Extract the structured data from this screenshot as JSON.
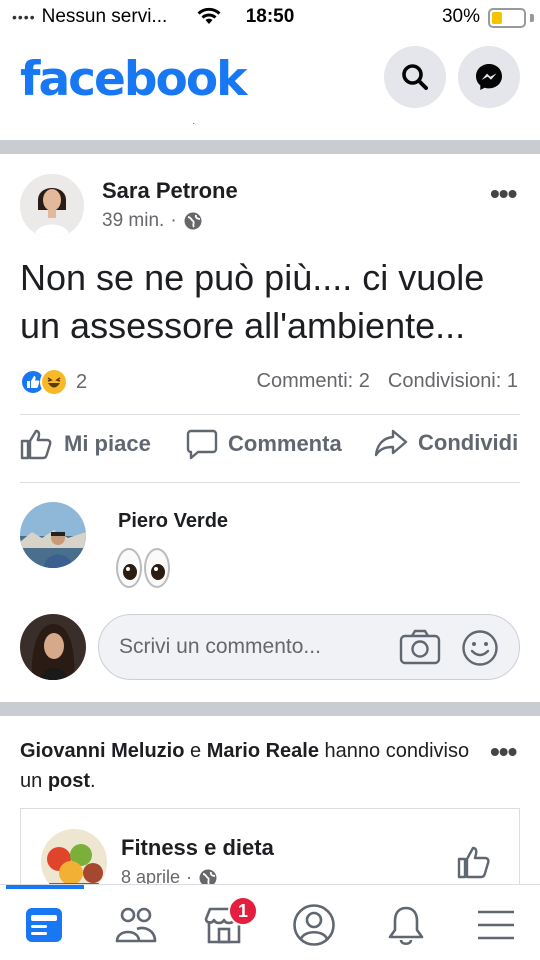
{
  "status_bar": {
    "carrier": "Nessun servi...",
    "time": "18:50",
    "battery_percent": "30%",
    "battery_level": 0.3,
    "signal_icon": "signal-dots-icon",
    "wifi_icon": "wifi-icon"
  },
  "header": {
    "logo": "facebook",
    "search_icon": "search-icon",
    "messenger_icon": "messenger-icon",
    "brand_color": "#1877f2"
  },
  "post": {
    "author": "Sara Petrone",
    "time": "39 min.",
    "privacy_separator": "·",
    "privacy_icon": "globe-icon",
    "text": "Non se ne può più.... ci vuole un assessore all'ambiente...",
    "reaction_count": "2",
    "comments": "Commenti: 2",
    "shares": "Condivisioni: 1",
    "actions": {
      "like": "Mi piace",
      "comment": "Commenta",
      "share": "Condividi"
    }
  },
  "comment": {
    "author": "Piero Verde",
    "content_emoji": "eyes",
    "input_placeholder": "Scrivi un commento...",
    "camera_icon": "camera-icon",
    "emoji_icon": "smiley-icon"
  },
  "shared_post": {
    "user1": "Giovanni Meluzio",
    "conj": "e",
    "user2": "Mario Reale",
    "text_mid": "hanno condiviso un",
    "post_word": "post",
    "period": ".",
    "page_name": "Fitness e dieta",
    "page_date": "8 aprile",
    "separator": "·"
  },
  "bottom_nav": {
    "items": [
      "news-feed-icon",
      "groups-icon",
      "marketplace-icon",
      "profile-icon",
      "notifications-icon",
      "menu-icon"
    ],
    "marketplace_badge": "1",
    "badge_color": "#e41e3f"
  }
}
